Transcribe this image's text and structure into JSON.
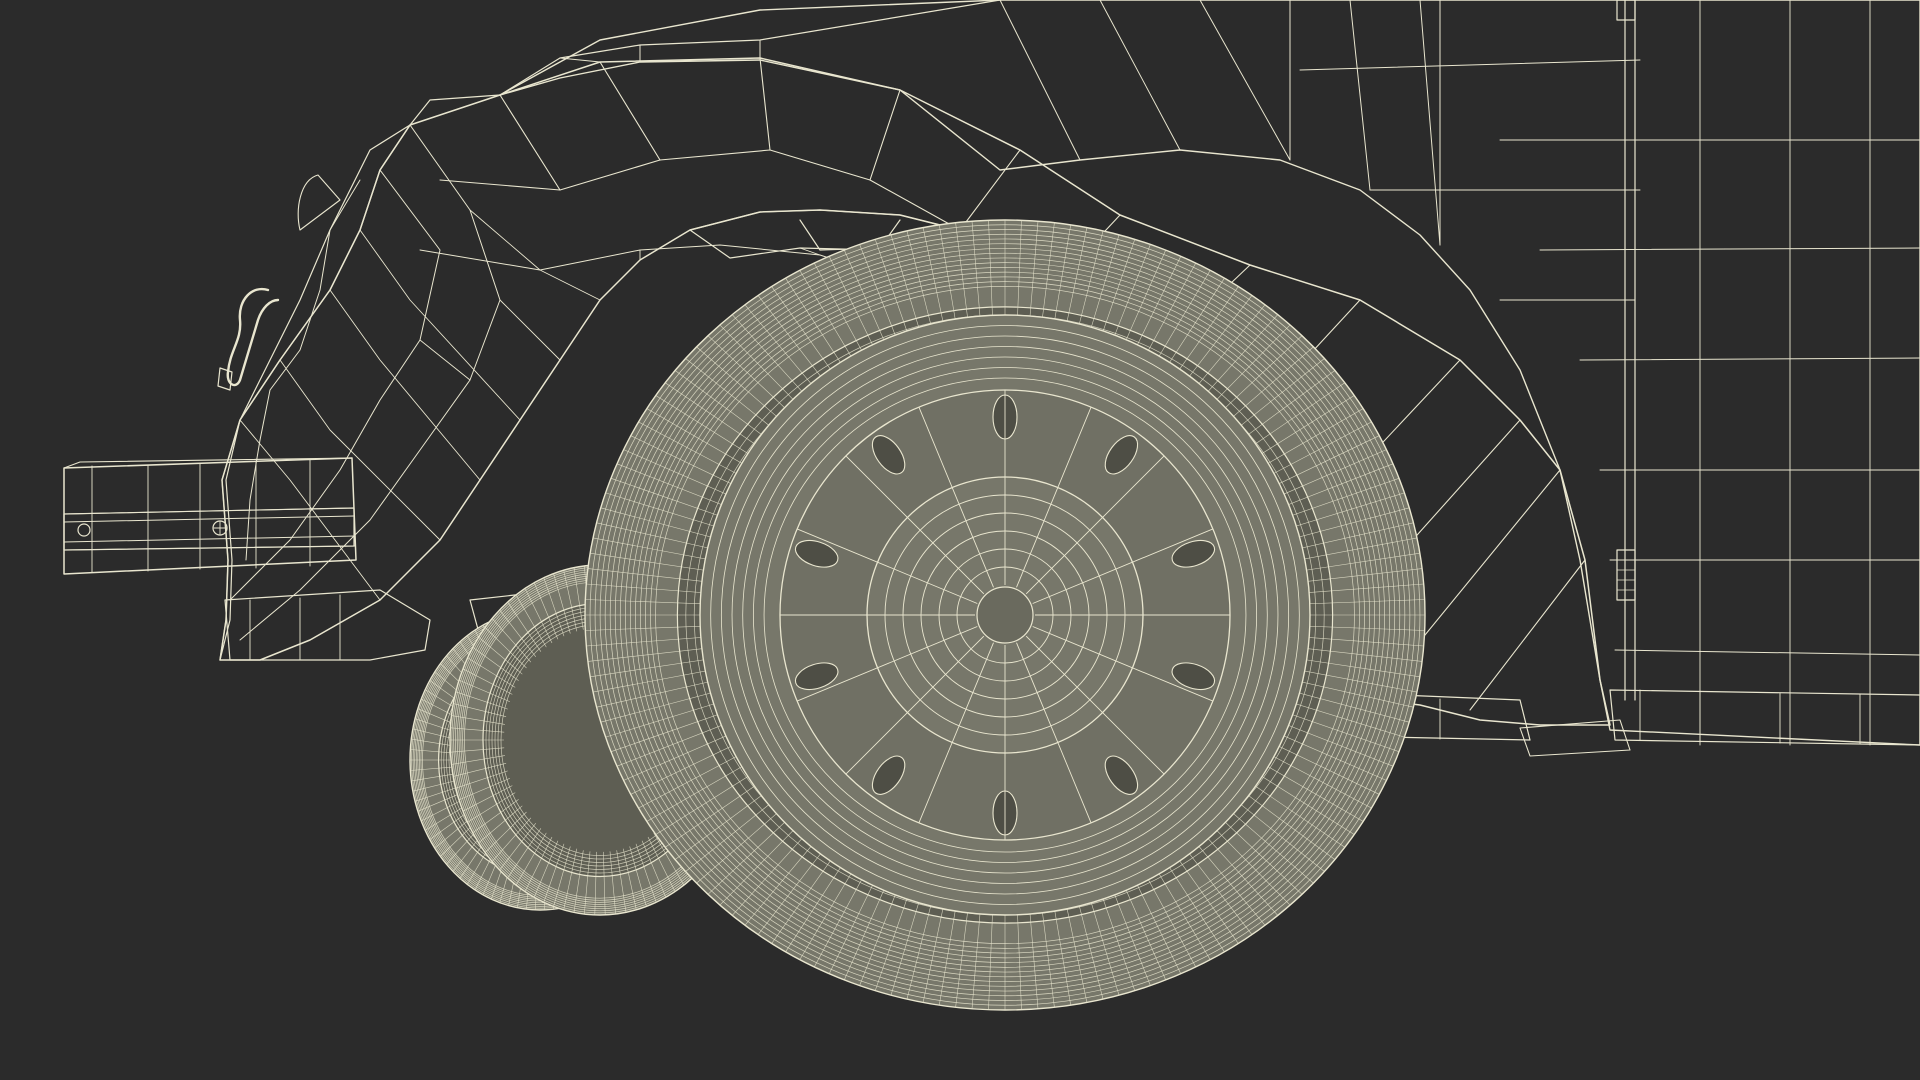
{
  "render": {
    "background_color": "#2b2b2b",
    "surface_color": "#77776a",
    "surface_shadow_color": "#5e5e53",
    "wire_color": "#e9e6cf",
    "icon": "car-wireframe-render"
  }
}
